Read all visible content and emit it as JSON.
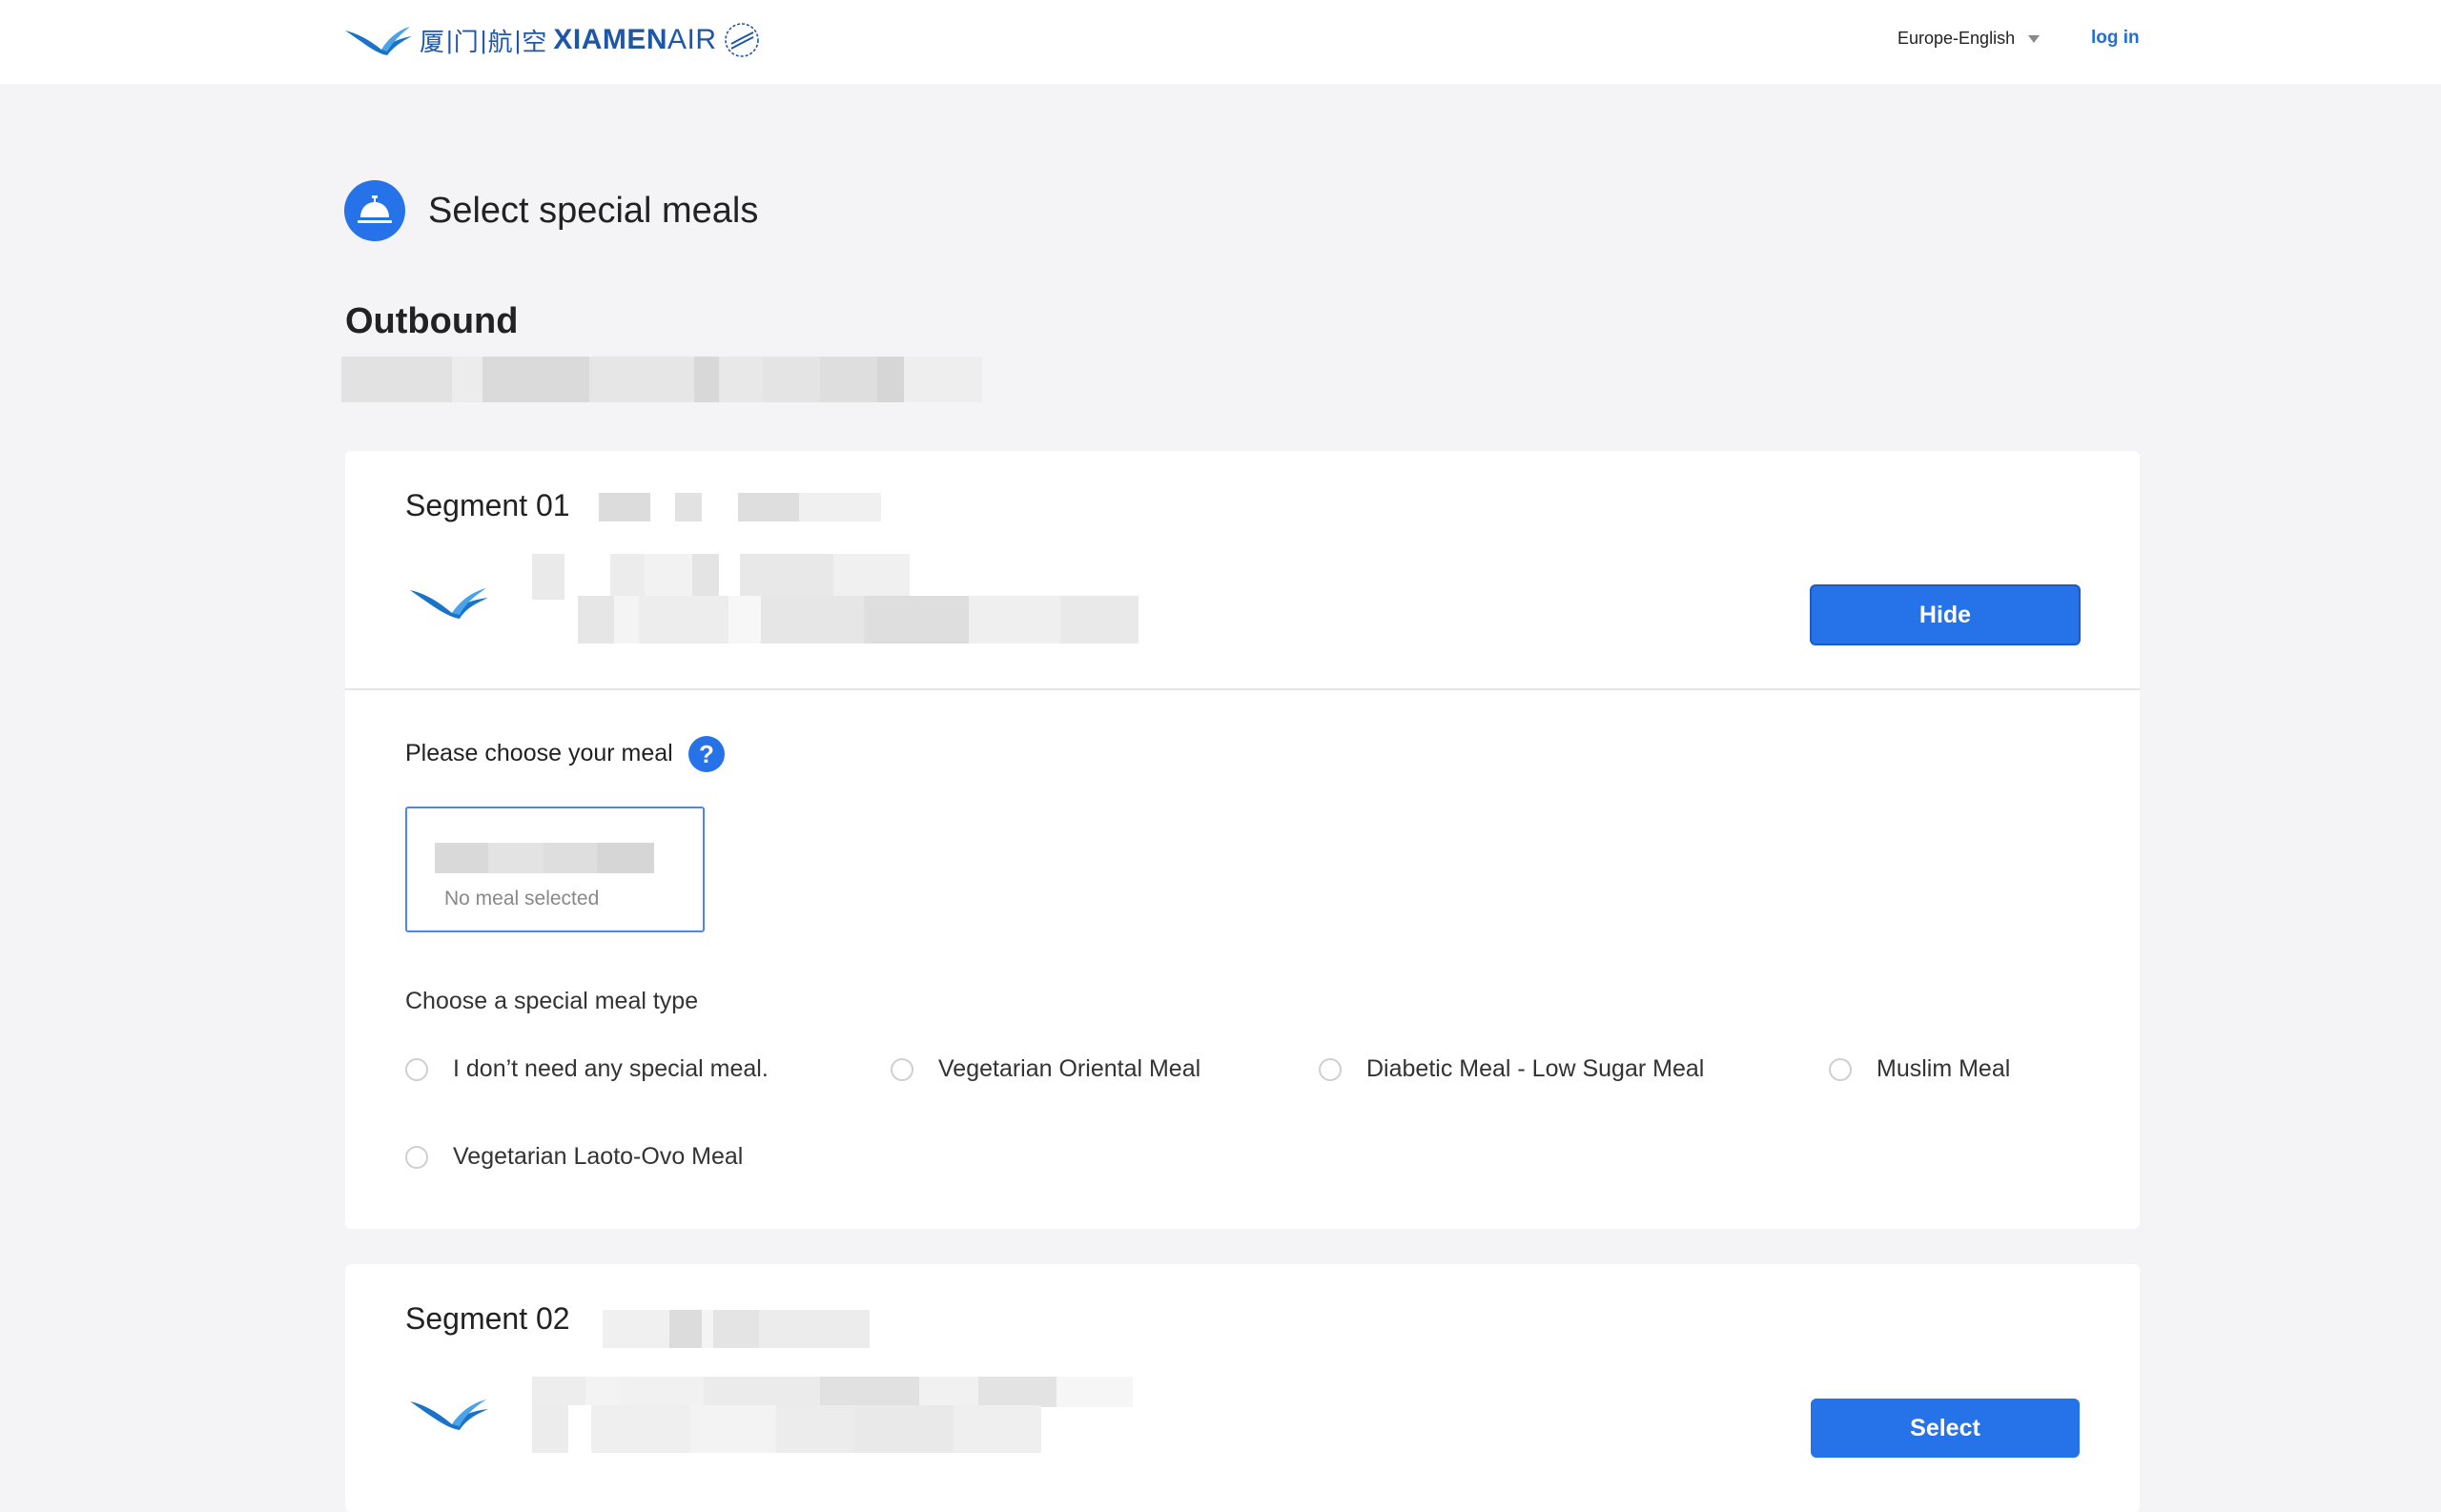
{
  "header": {
    "logo_cn": [
      "厦",
      "门",
      "航",
      "空"
    ],
    "logo_en_bold": "XIAMEN",
    "logo_en_light": "AIR",
    "language": "Europe-English",
    "login": "log in"
  },
  "page": {
    "title": "Select special meals",
    "direction": "Outbound"
  },
  "segments": [
    {
      "title": "Segment 01",
      "action": "Hide",
      "choose_meal_label": "Please choose your meal",
      "help_icon": "?",
      "meal_status": "No meal selected",
      "meal_type_label": "Choose a special meal type",
      "meal_options": [
        "I don’t need any special meal.",
        "Vegetarian Oriental Meal",
        "Diabetic Meal - Low Sugar Meal",
        "Muslim Meal",
        "Vegetarian Laoto-Ovo Meal"
      ]
    },
    {
      "title": "Segment 02",
      "action": "Select"
    }
  ],
  "colors": {
    "brand_blue": "#2672e8",
    "link_blue": "#1f6fd6",
    "logo_blue": "#1f57a8",
    "page_bg": "#f4f4f6"
  },
  "icons": {
    "page_icon": "service-bell-icon",
    "airline": "xiamenair-egret-icon",
    "language_caret": "caret-down-icon",
    "help": "question-icon"
  }
}
